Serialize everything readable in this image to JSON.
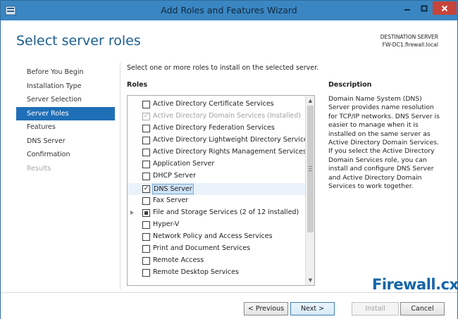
{
  "window": {
    "title": "Add Roles and Features Wizard",
    "buttons": {
      "minimize": "minimize",
      "maximize": "maximize",
      "close": "close"
    }
  },
  "page": {
    "heading": "Select server roles",
    "destination_label": "DESTINATION SERVER",
    "destination_server": "FW-DC1.firewall.local",
    "instruction": "Select one or more roles to install on the selected server.",
    "roles_label": "Roles",
    "description_label": "Description",
    "description_text": "Domain Name System (DNS) Server provides name resolution for TCP/IP networks. DNS Server is easier to manage when it is installed on the same server as Active Directory Domain Services. If you select the Active Directory Domain Services role, you can install and configure DNS Server and Active Directory Domain Services to work together."
  },
  "sidebar": {
    "items": [
      {
        "label": "Before You Begin",
        "state": "normal"
      },
      {
        "label": "Installation Type",
        "state": "normal"
      },
      {
        "label": "Server Selection",
        "state": "normal"
      },
      {
        "label": "Server Roles",
        "state": "active"
      },
      {
        "label": "Features",
        "state": "normal"
      },
      {
        "label": "DNS Server",
        "state": "normal"
      },
      {
        "label": "Confirmation",
        "state": "normal"
      },
      {
        "label": "Results",
        "state": "disabled"
      }
    ]
  },
  "roles": [
    {
      "label": "Active Directory Certificate Services",
      "checked": false,
      "disabled": false
    },
    {
      "label": "Active Directory Domain Services (Installed)",
      "checked": true,
      "disabled": true
    },
    {
      "label": "Active Directory Federation Services",
      "checked": false,
      "disabled": false
    },
    {
      "label": "Active Directory Lightweight Directory Services",
      "checked": false,
      "disabled": false
    },
    {
      "label": "Active Directory Rights Management Services",
      "checked": false,
      "disabled": false
    },
    {
      "label": "Application Server",
      "checked": false,
      "disabled": false
    },
    {
      "label": "DHCP Server",
      "checked": false,
      "disabled": false
    },
    {
      "label": "DNS Server",
      "checked": true,
      "disabled": false,
      "selected": true
    },
    {
      "label": "Fax Server",
      "checked": false,
      "disabled": false
    },
    {
      "label": "File and Storage Services (2 of 12 installed)",
      "checked": "partial",
      "disabled": false,
      "expandable": true
    },
    {
      "label": "Hyper-V",
      "checked": false,
      "disabled": false
    },
    {
      "label": "Network Policy and Access Services",
      "checked": false,
      "disabled": false
    },
    {
      "label": "Print and Document Services",
      "checked": false,
      "disabled": false
    },
    {
      "label": "Remote Access",
      "checked": false,
      "disabled": false
    },
    {
      "label": "Remote Desktop Services",
      "checked": false,
      "disabled": false
    }
  ],
  "buttons": {
    "previous": "< Previous",
    "next": "Next >",
    "install": "Install",
    "cancel": "Cancel"
  },
  "watermark": {
    "brand": "Firewall",
    "suffix": ".cx"
  },
  "colors": {
    "accent": "#1f6fb7",
    "titlebar": "#3a86c2",
    "close": "#c7443a"
  }
}
